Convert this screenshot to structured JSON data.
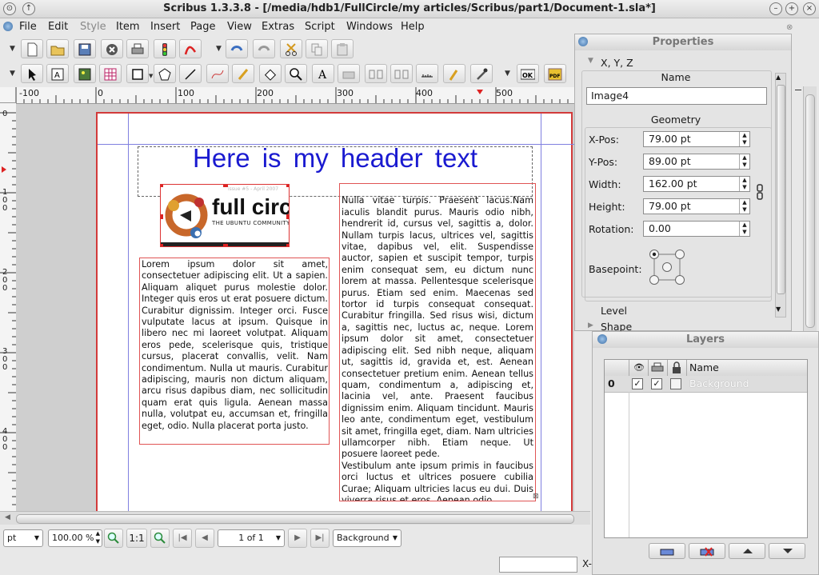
{
  "window": {
    "title": "Scribus 1.3.3.8 - [/media/hdb1/FullCircle/my articles/Scribus/part1/Document-1.sla*]",
    "menu": [
      "File",
      "Edit",
      "Style",
      "Item",
      "Insert",
      "Page",
      "View",
      "Extras",
      "Script",
      "Windows",
      "Help"
    ]
  },
  "rulers": {
    "h_labels": [
      "-100",
      "0",
      "100",
      "200",
      "300",
      "400",
      "500"
    ],
    "v_labels": [
      "0",
      "1\n0\n0",
      "2\n0\n0",
      "3\n0\n0",
      "4\n0\n0"
    ]
  },
  "document": {
    "header_text": "Here is my header text",
    "logo_text": "full circ",
    "logo_sub": "THE UBUNTU COMMUNITY",
    "logo_issue": "issue #5 - April 2007",
    "left_text": "Lorem ipsum dolor sit amet, consectetuer adipiscing elit. Ut a sapien. Aliquam aliquet purus molestie dolor. Integer quis eros ut erat posuere dictum. Curabitur dignissim. Integer orci. Fusce vulputate lacus at ipsum. Quisque in libero nec mi laoreet volutpat. Aliquam eros pede, scelerisque quis, tristique cursus, placerat convallis, velit. Nam condimentum. Nulla ut mauris. Curabitur adipiscing, mauris non dictum aliquam, arcu risus dapibus diam, nec sollicitudin quam erat quis ligula. Aenean massa nulla, volutpat eu, accumsan et, fringilla eget, odio. Nulla placerat porta justo.",
    "right_text": "Nulla vitae turpis. Praesent lacus.Nam iaculis blandit purus. Mauris odio nibh, hendrerit id, cursus vel, sagittis a, dolor. Nullam turpis lacus, ultrices vel, sagittis vitae, dapibus vel, elit. Suspendisse auctor, sapien et suscipit tempor, turpis enim consequat sem, eu dictum nunc lorem at massa. Pellentesque scelerisque purus. Etiam sed enim. Maecenas sed tortor id turpis consequat consequat. Curabitur fringilla. Sed risus wisi, dictum a, sagittis nec, luctus ac, neque. Lorem ipsum dolor sit amet, consectetuer adipiscing elit. Sed nibh neque, aliquam ut, sagittis id, gravida et, est. Aenean consectetuer pretium enim. Aenean tellus quam, condimentum a, adipiscing et, lacinia vel, ante. Praesent faucibus dignissim enim. Aliquam tincidunt. Mauris leo ante, condimentum eget, vestibulum sit amet, fringilla eget, diam. Nam ultricies ullamcorper nibh. Etiam neque. Ut posuere laoreet pede.\nVestibulum ante ipsum primis in faucibus orci luctus et ultrices posuere cubilia Curae; Aliquam ultricies lacus eu dui. Duis viverra risus et eros. Aenean odio"
  },
  "statusbar": {
    "unit": "pt",
    "zoom": "100.00 %",
    "ratio": "1:1",
    "page": "1 of 1",
    "layer": "Background",
    "coord_label": "X-"
  },
  "properties": {
    "title": "Properties",
    "section_xyz": "X, Y, Z",
    "name_label": "Name",
    "name_value": "Image4",
    "geometry_label": "Geometry",
    "fields": [
      {
        "label": "X-Pos:",
        "value": "79.00 pt"
      },
      {
        "label": "Y-Pos:",
        "value": "89.00 pt"
      },
      {
        "label": "Width:",
        "value": "162.00 pt"
      },
      {
        "label": "Height:",
        "value": "79.00 pt"
      },
      {
        "label": "Rotation:",
        "value": "0.00"
      }
    ],
    "basepoint_label": "Basepoint:",
    "level_label": "Level",
    "shape_label": "Shape"
  },
  "layers": {
    "title": "Layers",
    "col_name": "Name",
    "row_index": "0",
    "row_name": "Background"
  },
  "colors": {
    "header_blue": "#1a1ad0",
    "page_border": "#d23a3a",
    "frame_red": "#e05555"
  }
}
